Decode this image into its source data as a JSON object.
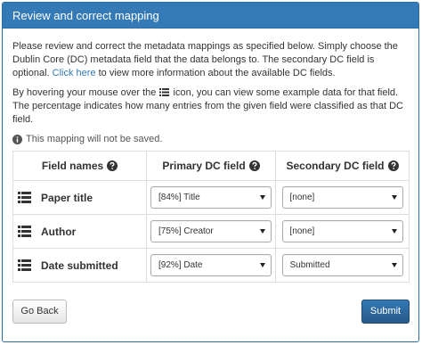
{
  "panel": {
    "title": "Review and correct mapping"
  },
  "intro": {
    "before_link": "Please review and correct the metadata mappings as specified below. Simply choose the Dublin Core (DC) metadata field that the data belongs to. The secondary DC field is optional.",
    "link_text": "Click here",
    "after_link": " to view more information about the available DC fields."
  },
  "hover_text": {
    "before_icon": "By hovering your mouse over the",
    "after_icon": "icon, you can view some example data for that field. The percentage indicates how many entries from the given field were classified as that DC field."
  },
  "note": {
    "icon": "info-circle-icon",
    "text": "This mapping will not be saved."
  },
  "table": {
    "headers": {
      "field": "Field names",
      "primary": "Primary DC field",
      "secondary": "Secondary DC field"
    },
    "rows": [
      {
        "field": "Paper title",
        "primary": "[84%] Title",
        "secondary": "[none]"
      },
      {
        "field": "Author",
        "primary": "[75%] Creator",
        "secondary": "[none]"
      },
      {
        "field": "Date submitted",
        "primary": "[92%] Date",
        "secondary": "Submitted"
      }
    ]
  },
  "buttons": {
    "back": "Go Back",
    "submit": "Submit"
  },
  "colors": {
    "heading_bg": "#337ab7",
    "link": "#337ab7",
    "primary_button": "#286090"
  }
}
